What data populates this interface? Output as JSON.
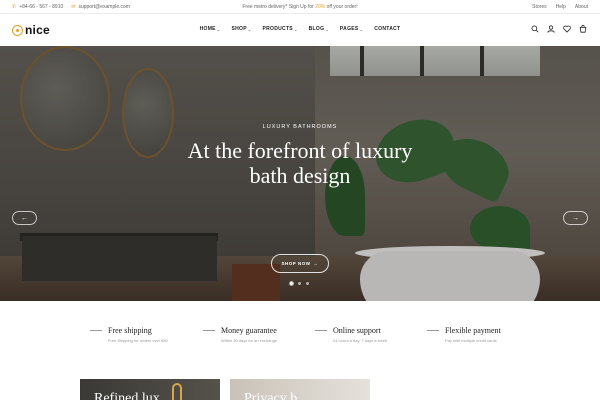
{
  "topbar": {
    "phone": "+84-66 - 567 - 8910",
    "email": "support@example.com",
    "promo_prefix": "Free metro delivery* Sign Up for ",
    "promo_highlight": "20%",
    "promo_suffix": " off your order!",
    "links": [
      "Stores",
      "Help",
      "About"
    ]
  },
  "header": {
    "logo": "nice",
    "nav": [
      "HOME",
      "SHOP",
      "PRODUCTS",
      "BLOG",
      "PAGES",
      "CONTACT"
    ],
    "icons": [
      "search-icon",
      "user-icon",
      "heart-icon",
      "cart-icon"
    ]
  },
  "hero": {
    "kicker": "LUXURY BATHROOMS",
    "title_line1": "At the forefront of luxury",
    "title_line2": "bath design",
    "button": "SHOP NOW",
    "button_arrow": "→",
    "prev_arrow": "←",
    "next_arrow": "→",
    "slides": 3,
    "active_slide": 1
  },
  "features": [
    {
      "title": "Free shipping",
      "desc": "Free Shipping for orders over €80"
    },
    {
      "title": "Money guarantee",
      "desc": "Within 30 days for an exchange"
    },
    {
      "title": "Online support",
      "desc": "24 hours a day, 7 days a week"
    },
    {
      "title": "Flexible payment",
      "desc": "Pay with multiple credit cards"
    }
  ],
  "promo_cards": [
    {
      "title": "Refined lux"
    },
    {
      "title": "Privacy b"
    }
  ],
  "colors": {
    "accent": "#e0a22a",
    "text": "#222222",
    "muted": "#999999"
  }
}
